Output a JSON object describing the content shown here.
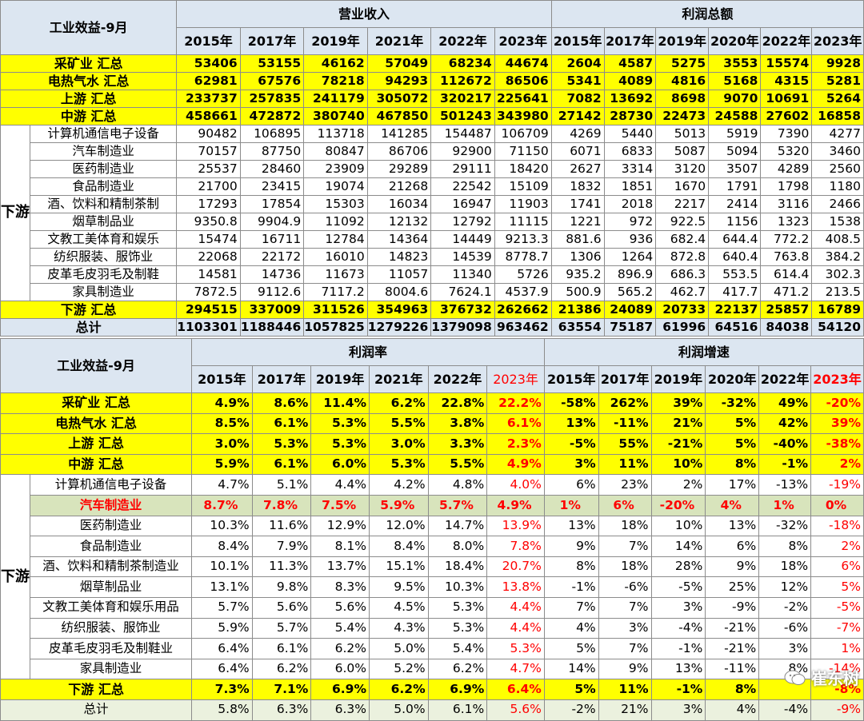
{
  "table1": {
    "title": "工业效益-9月",
    "group_headers": [
      "营业收入",
      "利润总额"
    ],
    "rev_years": [
      "2015年",
      "2017年",
      "2019年",
      "2021年",
      "2022年",
      "2023年"
    ],
    "profit_years": [
      "2015年",
      "2017年",
      "2019年",
      "2020年",
      "2022年",
      "2023年"
    ],
    "rows": [
      {
        "label": "采矿业 汇总",
        "type": "yel",
        "values": [
          "53406",
          "53155",
          "46162",
          "57049",
          "68234",
          "44674",
          "2604",
          "4587",
          "5275",
          "3553",
          "15574",
          "9928"
        ]
      },
      {
        "label": "电热气水 汇总",
        "type": "yel",
        "values": [
          "62981",
          "67576",
          "78218",
          "94293",
          "112672",
          "86506",
          "5341",
          "4089",
          "4816",
          "5168",
          "4315",
          "5281"
        ]
      },
      {
        "label": "上游 汇总",
        "type": "yel",
        "values": [
          "233737",
          "257835",
          "241179",
          "305072",
          "320217",
          "225641",
          "7082",
          "13692",
          "8698",
          "9070",
          "10691",
          "5264"
        ]
      },
      {
        "label": "中游 汇总",
        "type": "yel",
        "values": [
          "458661",
          "472872",
          "380740",
          "467850",
          "501243",
          "343980",
          "27142",
          "28730",
          "22473",
          "24588",
          "27602",
          "16858"
        ]
      },
      {
        "label": "计算机通信电子设备",
        "type": "sub",
        "values": [
          "90482",
          "106895",
          "113718",
          "141285",
          "154487",
          "106709",
          "4269",
          "5440",
          "5013",
          "5919",
          "7390",
          "4277"
        ]
      },
      {
        "label": "汽车制造业",
        "type": "sub",
        "values": [
          "70157",
          "87750",
          "80847",
          "86706",
          "92900",
          "71150",
          "6071",
          "6833",
          "5087",
          "5094",
          "5320",
          "3460"
        ]
      },
      {
        "label": "医药制造业",
        "type": "sub",
        "values": [
          "25537",
          "28460",
          "23909",
          "29289",
          "29111",
          "18420",
          "2627",
          "3314",
          "3120",
          "3507",
          "4289",
          "2560"
        ]
      },
      {
        "label": "食品制造业",
        "type": "sub",
        "values": [
          "21700",
          "23415",
          "19074",
          "21268",
          "22542",
          "15109",
          "1832",
          "1851",
          "1670",
          "1791",
          "1798",
          "1180"
        ]
      },
      {
        "label": "酒、饮料和精制茶制",
        "type": "sub",
        "values": [
          "17293",
          "17854",
          "15303",
          "16034",
          "16947",
          "11903",
          "1741",
          "2018",
          "2217",
          "2414",
          "3116",
          "2466"
        ]
      },
      {
        "label": "烟草制品业",
        "type": "sub",
        "values": [
          "9350.8",
          "9904.9",
          "11092",
          "12132",
          "12792",
          "11115",
          "1221",
          "972",
          "922.5",
          "1156",
          "1323",
          "1538"
        ]
      },
      {
        "label": "文教工美体育和娱乐",
        "type": "sub",
        "values": [
          "15474",
          "16711",
          "12784",
          "14364",
          "14449",
          "9213.3",
          "881.6",
          "936",
          "682.4",
          "644.4",
          "772.2",
          "408.5"
        ]
      },
      {
        "label": "纺织服装、服饰业",
        "type": "sub",
        "values": [
          "22068",
          "22172",
          "16010",
          "14823",
          "14539",
          "8778.7",
          "1306",
          "1264",
          "872.8",
          "640.4",
          "763.8",
          "384.2"
        ]
      },
      {
        "label": "皮革毛皮羽毛及制鞋",
        "type": "sub",
        "values": [
          "14581",
          "14736",
          "11673",
          "11057",
          "11340",
          "5726",
          "935.2",
          "896.9",
          "686.3",
          "553.5",
          "614.4",
          "302.3"
        ]
      },
      {
        "label": "家具制造业",
        "type": "sub",
        "values": [
          "7872.5",
          "9112.6",
          "7117.2",
          "8004.6",
          "7624.1",
          "4537.9",
          "500.9",
          "565.2",
          "462.7",
          "417.7",
          "471.2",
          "213.5"
        ]
      },
      {
        "label": "下游 汇总",
        "type": "yel",
        "values": [
          "294515",
          "337009",
          "311526",
          "354963",
          "376732",
          "262662",
          "21386",
          "24089",
          "20733",
          "22137",
          "25857",
          "16789"
        ]
      },
      {
        "label": "总计",
        "type": "tot",
        "values": [
          "1103301",
          "1188446",
          "1057825",
          "1279226",
          "1379098",
          "963462",
          "63554",
          "75187",
          "61996",
          "64516",
          "84038",
          "54120"
        ]
      }
    ]
  },
  "table2": {
    "title": "工业效益-9月",
    "group_headers": [
      "利润率",
      "利润增速"
    ],
    "rate_years": [
      "2015年",
      "2017年",
      "2019年",
      "2021年",
      "2022年",
      "2023年"
    ],
    "growth_years": [
      "2015年",
      "2017年",
      "2019年",
      "2020年",
      "2022年",
      "2023年"
    ],
    "rows": [
      {
        "label": "采矿业 汇总",
        "type": "yel",
        "values": [
          "4.9%",
          "8.6%",
          "11.4%",
          "6.2%",
          "22.8%",
          "22.2%",
          "-58%",
          "262%",
          "39%",
          "-32%",
          "49%",
          "-20%"
        ]
      },
      {
        "label": "电热气水 汇总",
        "type": "yel",
        "values": [
          "8.5%",
          "6.1%",
          "5.3%",
          "5.5%",
          "3.8%",
          "6.1%",
          "13%",
          "-11%",
          "21%",
          "5%",
          "42%",
          "39%"
        ]
      },
      {
        "label": "上游 汇总",
        "type": "yel",
        "values": [
          "3.0%",
          "5.3%",
          "5.3%",
          "3.0%",
          "3.3%",
          "2.3%",
          "-5%",
          "55%",
          "-21%",
          "5%",
          "-40%",
          "-38%"
        ]
      },
      {
        "label": "中游 汇总",
        "type": "yel",
        "values": [
          "5.9%",
          "6.1%",
          "6.0%",
          "5.3%",
          "5.5%",
          "4.9%",
          "3%",
          "11%",
          "10%",
          "8%",
          "-1%",
          "2%"
        ]
      },
      {
        "label": "计算机通信电子设备",
        "type": "sub",
        "values": [
          "4.7%",
          "5.1%",
          "4.4%",
          "4.2%",
          "4.8%",
          "4.0%",
          "6%",
          "23%",
          "2%",
          "17%",
          "-13%",
          "-19%"
        ]
      },
      {
        "label": "汽车制造业",
        "type": "auto",
        "values": [
          "8.7%",
          "7.8%",
          "7.5%",
          "5.9%",
          "5.7%",
          "4.9%",
          "1%",
          "6%",
          "-20%",
          "4%",
          "1%",
          "0%"
        ]
      },
      {
        "label": "医药制造业",
        "type": "sub",
        "values": [
          "10.3%",
          "11.6%",
          "12.9%",
          "12.0%",
          "14.7%",
          "13.9%",
          "13%",
          "18%",
          "10%",
          "13%",
          "-32%",
          "-18%"
        ]
      },
      {
        "label": "食品制造业",
        "type": "sub",
        "values": [
          "8.4%",
          "7.9%",
          "8.1%",
          "8.4%",
          "8.0%",
          "7.8%",
          "9%",
          "7%",
          "14%",
          "6%",
          "8%",
          "2%"
        ]
      },
      {
        "label": "酒、饮料和精制茶制造业",
        "type": "sub",
        "values": [
          "10.1%",
          "11.3%",
          "13.7%",
          "15.1%",
          "18.4%",
          "20.7%",
          "8%",
          "18%",
          "28%",
          "9%",
          "18%",
          "6%"
        ]
      },
      {
        "label": "烟草制品业",
        "type": "sub",
        "values": [
          "13.1%",
          "9.8%",
          "8.3%",
          "9.5%",
          "10.3%",
          "13.8%",
          "-1%",
          "-6%",
          "-5%",
          "25%",
          "12%",
          "5%"
        ]
      },
      {
        "label": "文教工美体育和娱乐用品",
        "type": "sub",
        "values": [
          "5.7%",
          "5.6%",
          "5.6%",
          "4.5%",
          "5.3%",
          "4.4%",
          "7%",
          "7%",
          "3%",
          "-9%",
          "-2%",
          "-5%"
        ]
      },
      {
        "label": "纺织服装、服饰业",
        "type": "sub",
        "values": [
          "5.9%",
          "5.7%",
          "5.4%",
          "4.3%",
          "5.3%",
          "4.4%",
          "4%",
          "3%",
          "-4%",
          "-21%",
          "-6%",
          "-7%"
        ]
      },
      {
        "label": "皮革毛皮羽毛及制鞋业",
        "type": "sub",
        "values": [
          "6.4%",
          "6.1%",
          "6.2%",
          "5.0%",
          "5.4%",
          "5.3%",
          "5%",
          "7%",
          "-1%",
          "-21%",
          "3%",
          "1%"
        ]
      },
      {
        "label": "家具制造业",
        "type": "sub",
        "values": [
          "6.4%",
          "6.2%",
          "6.0%",
          "5.2%",
          "6.2%",
          "4.7%",
          "14%",
          "9%",
          "13%",
          "-11%",
          "8%",
          "-14%"
        ]
      },
      {
        "label": "下游 汇总",
        "type": "yel",
        "values": [
          "7.3%",
          "7.1%",
          "6.9%",
          "6.2%",
          "6.9%",
          "6.4%",
          "5%",
          "11%",
          "-1%",
          "8%",
          "",
          "-8%"
        ]
      },
      {
        "label": "总计",
        "type": "tot2",
        "values": [
          "5.8%",
          "6.3%",
          "6.3%",
          "5.0%",
          "6.1%",
          "5.6%",
          "-2%",
          "21%",
          "3%",
          "4%",
          "-4%",
          "-9%"
        ]
      }
    ]
  },
  "downstream_label": "下游",
  "watermark": "崔东树"
}
